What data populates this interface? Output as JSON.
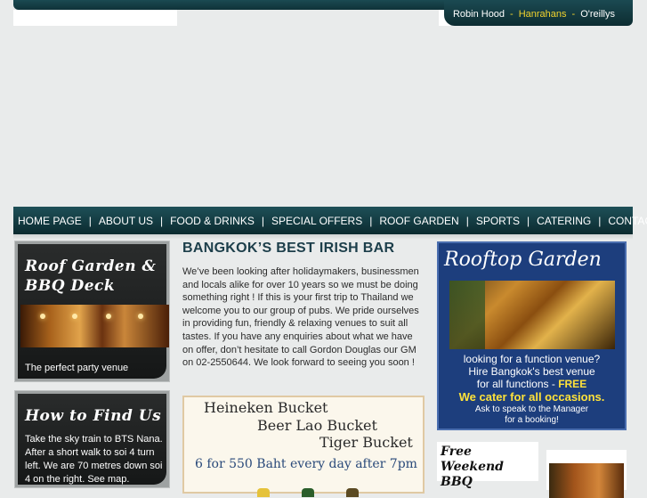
{
  "header": {
    "links": [
      {
        "label": "Robin Hood",
        "active": false
      },
      {
        "label": "Hanrahans",
        "active": true
      },
      {
        "label": "O'reillys",
        "active": false
      }
    ],
    "separator": "-"
  },
  "nav": {
    "separator": "|",
    "items": [
      {
        "label": "HOME PAGE"
      },
      {
        "label": "ABOUT US"
      },
      {
        "label": "FOOD & DRINKS"
      },
      {
        "label": "SPECIAL OFFERS"
      },
      {
        "label": "ROOF GARDEN"
      },
      {
        "label": "SPORTS"
      },
      {
        "label": "CATERING"
      },
      {
        "label": "CONTACT US"
      }
    ]
  },
  "left": {
    "roof_box": {
      "title": "Roof Garden & BBQ Deck",
      "caption": "The perfect party venue"
    },
    "find_box": {
      "title": "How to Find Us",
      "text": "Take the sky train to BTS Nana. After a short walk to soi 4 turn left. We are 70 metres down soi 4 on the right. See map."
    }
  },
  "main": {
    "title": "BANGKOK’S BEST IRISH BAR",
    "text": "We’ve been looking after holidaymakers, businessmen and locals alike for over 10 years so we must be doing something right ! If this is your first trip to Thailand we welcome you to our group of pubs. We pride ourselves in providing fun, friendly & relaxing venues to suit all tastes. If you have any enquiries about what we have on offer, don’t hesitate to call Gordon Douglas our GM on 02-2550644. We look forward to seeing you soon !",
    "promo": {
      "line1": "Heineken Bucket",
      "line2": "Beer Lao Bucket",
      "line3": "Tiger Bucket",
      "line4": "6 for 550 Baht every day after 7pm"
    }
  },
  "right": {
    "rooftop": {
      "title": "Rooftop Garden",
      "line1": "looking for a function venue?",
      "line2": "Hire Bangkok's best venue",
      "line3_text": "for all functions -",
      "line3_free": "FREE",
      "line4": "We cater for all occasions.",
      "line5": "Ask to speak to the Manager",
      "line6": "for a booking!"
    },
    "bbq": {
      "title_line1": "Free Weekend",
      "title_line2": "BBQ"
    }
  },
  "colors": {
    "nav_bg": "#1e5058",
    "highlight": "#f2d32d",
    "page_bg": "#e9ebeb",
    "title_color": "#1c3e4a",
    "rooftop_bg": "#1d3e7d"
  }
}
